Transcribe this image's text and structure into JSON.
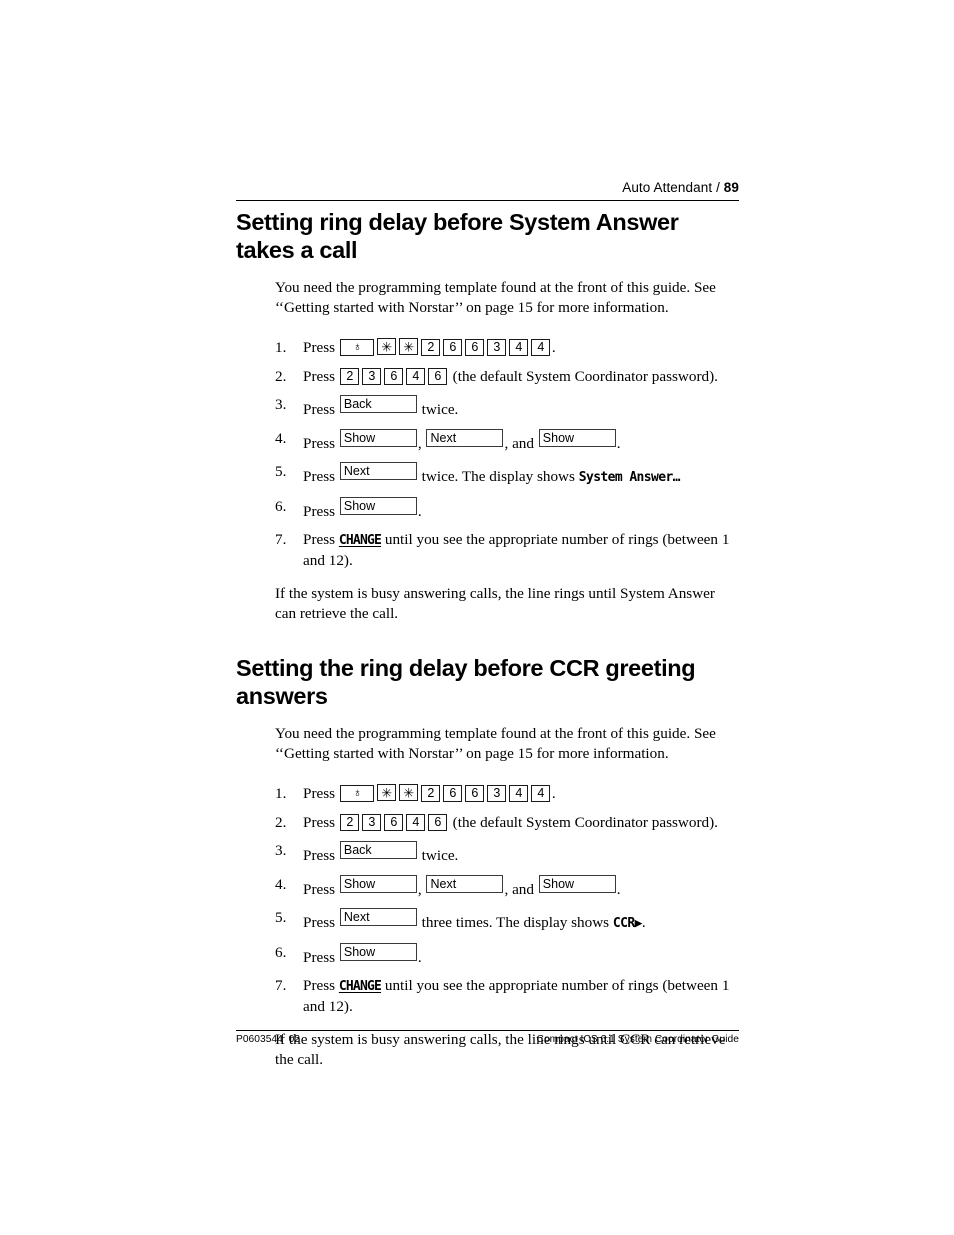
{
  "header": {
    "chapter": "Auto Attendant",
    "separator": "/",
    "page_number": "89"
  },
  "footer": {
    "doc_code": "P0603544",
    "doc_revision": "02",
    "guide_title": "Compact ICS 6.1 System Coordinator Guide"
  },
  "sections": [
    {
      "title": "Setting ring delay before System Answer takes a call",
      "intro": "You need the programming template found at the front of this guide. See ‘‘Getting started with Norstar’’ on page 15 for more information.",
      "steps": {
        "n1": "1.",
        "n2": "2.",
        "n3": "3.",
        "n4": "4.",
        "n5": "5.",
        "n6": "6.",
        "n7": "7."
      },
      "step1": {
        "press": "Press",
        "keys": [
          "feature",
          "✳",
          "✳",
          "2",
          "6",
          "6",
          "3",
          "4",
          "4"
        ],
        "feature_glyph": "♁",
        "trailing": "."
      },
      "step2": {
        "press": "Press",
        "keys": [
          "2",
          "3",
          "6",
          "4",
          "6"
        ],
        "trailing": "(the default System Coordinator password)."
      },
      "step3": {
        "press": "Press",
        "softkey": "Back",
        "trailing": "twice."
      },
      "step4": {
        "press": "Press",
        "softkey1": "Show",
        "sep1": ",",
        "softkey2": "Next",
        "sep2": ", and",
        "softkey3": "Show",
        "trailing": "."
      },
      "step5": {
        "press": "Press",
        "softkey": "Next",
        "mid": "twice. The display shows",
        "display": "System Answer…"
      },
      "step6": {
        "press": "Press",
        "softkey": "Show",
        "trailing": "."
      },
      "step7": {
        "press": "Press",
        "display_label": "CHANGE",
        "trailing": "until you see the appropriate number of rings (between 1 and 12)."
      },
      "outro": "If the system is busy answering calls, the line rings until System Answer can retrieve the call."
    },
    {
      "title": "Setting the ring delay before CCR greeting answers",
      "intro": "You need the programming template found at the front of this guide. See ‘‘Getting started with Norstar’’ on page 15 for more information.",
      "steps": {
        "n1": "1.",
        "n2": "2.",
        "n3": "3.",
        "n4": "4.",
        "n5": "5.",
        "n6": "6.",
        "n7": "7."
      },
      "step1": {
        "press": "Press",
        "keys": [
          "feature",
          "✳",
          "✳",
          "2",
          "6",
          "6",
          "3",
          "4",
          "4"
        ],
        "feature_glyph": "♁",
        "trailing": "."
      },
      "step2": {
        "press": "Press",
        "keys": [
          "2",
          "3",
          "6",
          "4",
          "6"
        ],
        "trailing": "(the default System Coordinator password)."
      },
      "step3": {
        "press": "Press",
        "softkey": "Back",
        "trailing": "twice."
      },
      "step4": {
        "press": "Press",
        "softkey1": "Show",
        "sep1": ",",
        "softkey2": "Next",
        "sep2": ", and",
        "softkey3": "Show",
        "trailing": "."
      },
      "step5": {
        "press": "Press",
        "softkey": "Next",
        "mid": "three times. The display shows",
        "display": "CCR",
        "display_arrow": "▶",
        "trailing": "."
      },
      "step6": {
        "press": "Press",
        "softkey": "Show",
        "trailing": "."
      },
      "step7": {
        "press": "Press",
        "display_label": "CHANGE",
        "trailing": "until you see the appropriate number of rings (between 1 and 12)."
      },
      "outro": "If the system is busy answering calls, the line rings until CCR can retrieve the call."
    }
  ]
}
